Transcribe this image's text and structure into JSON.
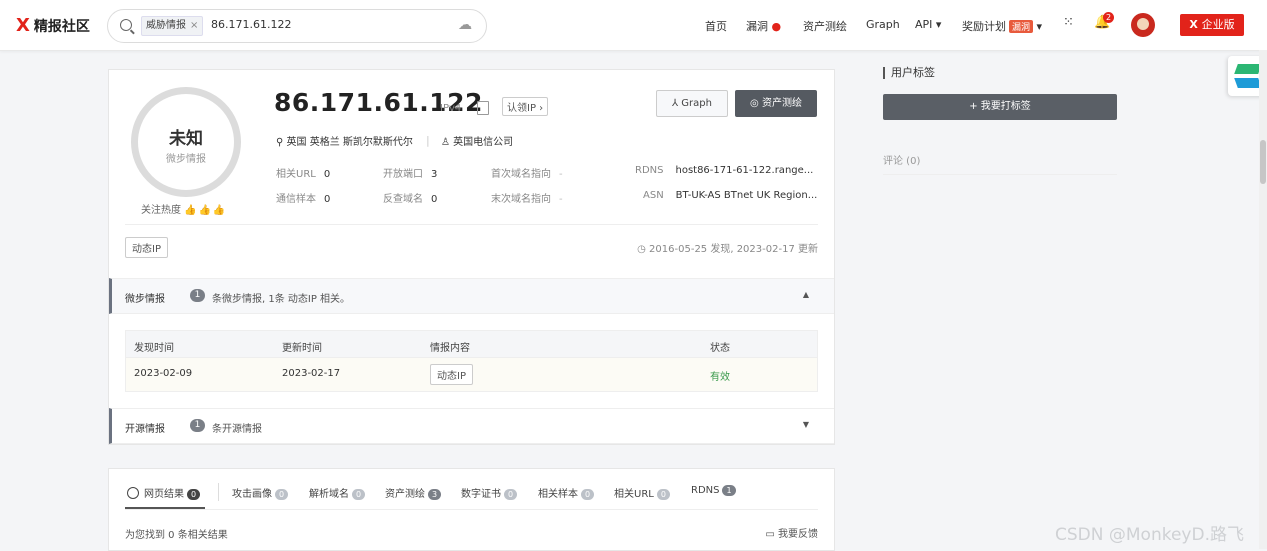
{
  "brand": {
    "x": "X",
    "name": "精报社区",
    "accent": "#e2231a"
  },
  "search": {
    "tag": "威胁情报",
    "value": "86.171.61.122"
  },
  "nav": {
    "home": "首页",
    "vuln": "漏洞",
    "assets": "资产测绘",
    "graph": "Graph",
    "api": "API ▾",
    "reward": "奖励计划",
    "reward_badge": "漏洞",
    "notif_count": "2",
    "enterprise": "企业版"
  },
  "profile": {
    "verdict": "未知",
    "verdict_sub": "微步情报",
    "heat_label": "关注热度",
    "ip": "86.171.61.122",
    "ip_type": "IPv4",
    "claim": "认领IP ›",
    "graph_btn": "Graph",
    "asset_btn": "资产测绘",
    "location": "英国 英格兰 斯凯尔默斯代尔",
    "isp": "英国电信公司",
    "stats": [
      {
        "k": "相关URL",
        "v": "0"
      },
      {
        "k": "开放端口",
        "v": "3"
      },
      {
        "k": "首次域名指向",
        "v": "-"
      },
      {
        "k": "RDNS",
        "v": "host86-171-61-122.range..."
      },
      {
        "k": "通信样本",
        "v": "0"
      },
      {
        "k": "反查域名",
        "v": "0"
      },
      {
        "k": "末次域名指向",
        "v": "-"
      },
      {
        "k": "ASN",
        "v": "BT-UK-AS BTnet UK Region..."
      }
    ],
    "tag": "动态IP",
    "dates": "2016-05-25 发现, 2023-02-17 更新"
  },
  "intel": {
    "title": "微步情报",
    "count": "1",
    "desc": "条微步情报, 1条 动态IP 相关。",
    "headers": [
      "发现时间",
      "更新时间",
      "情报内容",
      "状态"
    ],
    "rows": [
      {
        "found": "2023-02-09",
        "updated": "2023-02-17",
        "content": "动态IP",
        "status": "有效"
      }
    ]
  },
  "osint": {
    "title": "开源情报",
    "count": "1",
    "desc": "条开源情报"
  },
  "tabs": [
    {
      "label": "网页结果",
      "n": "0"
    },
    {
      "label": "攻击画像",
      "n": "0"
    },
    {
      "label": "解析域名",
      "n": "0"
    },
    {
      "label": "资产测绘",
      "n": "3"
    },
    {
      "label": "数字证书",
      "n": "0"
    },
    {
      "label": "相关样本",
      "n": "0"
    },
    {
      "label": "相关URL",
      "n": "0"
    },
    {
      "label": "RDNS",
      "n": "1"
    }
  ],
  "results": {
    "count_text": "为您找到 0 条相关结果",
    "feedback": "我要反馈"
  },
  "sidebar": {
    "user_tags": "用户标签",
    "tag_btn": "+ 我要打标签",
    "comments": "评论 (0)"
  },
  "watermark": "CSDN @MonkeyD.路飞"
}
